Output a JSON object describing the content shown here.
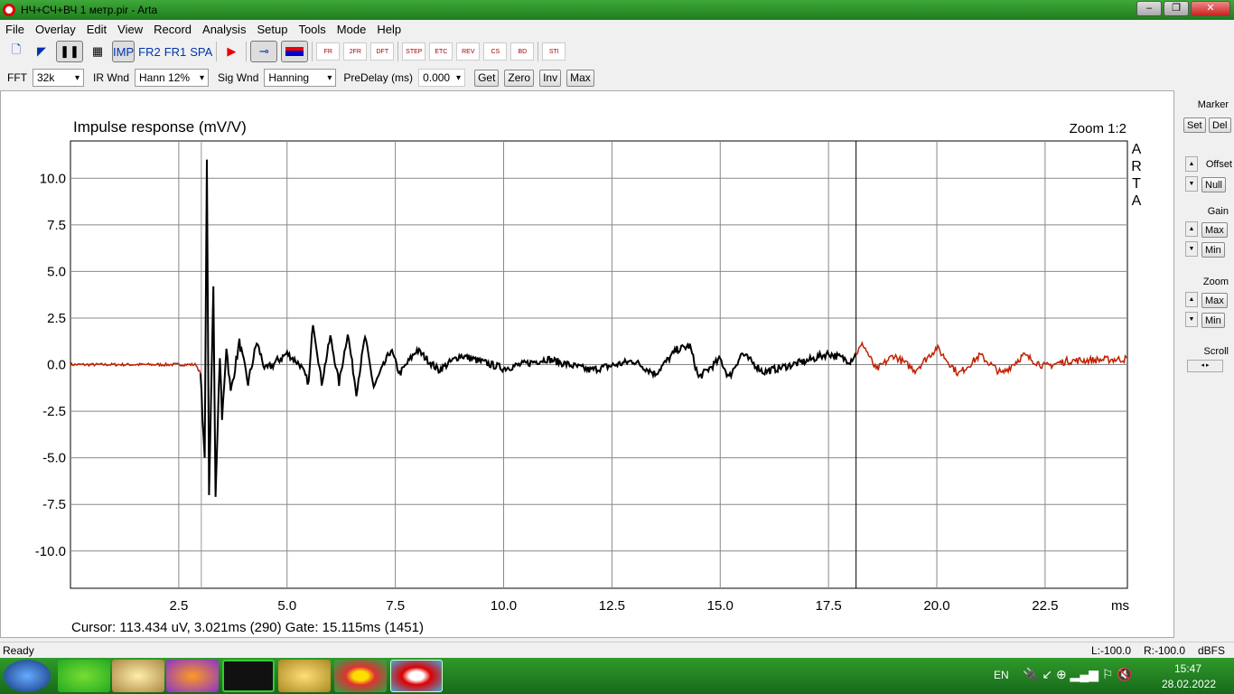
{
  "window": {
    "title": "НЧ+СЧ+ВЧ 1 метр.pir - Arta",
    "buttons": [
      "‒",
      "❐",
      "✕"
    ]
  },
  "menu": [
    "File",
    "Overlay",
    "Edit",
    "View",
    "Record",
    "Analysis",
    "Setup",
    "Tools",
    "Mode",
    "Help"
  ],
  "toolbar": {
    "imp": "IMP",
    "fr2": "FR2",
    "fr1": "FR1",
    "spa": "SPA",
    "graphs": [
      "FR",
      "2FR",
      "DFT",
      "STEP",
      "ETC",
      "REV",
      "CS",
      "BD",
      "STI"
    ]
  },
  "controls": {
    "fft_label": "FFT",
    "fft": "32k",
    "irwnd_label": "IR Wnd",
    "irwnd": "Hann 12%",
    "sigwnd_label": "Sig Wnd",
    "sigwnd": "Hanning",
    "predelay_label": "PreDelay (ms)",
    "predelay": "0.000",
    "get": "Get",
    "zero": "Zero",
    "inv": "Inv",
    "max": "Max"
  },
  "side": {
    "marker": "Marker",
    "set": "Set",
    "del": "Del",
    "offset": "Offset",
    "null": "Null",
    "gain": "Gain",
    "gain_max": "Max",
    "gain_min": "Min",
    "zoom": "Zoom",
    "zoom_max": "Max",
    "zoom_min": "Min",
    "scroll": "Scroll"
  },
  "chart_data": {
    "type": "line",
    "title": "Impulse response (mV/V)",
    "zoom_label": "Zoom 1:2",
    "watermark": "ARTA",
    "xlabel": "ms",
    "xlim": [
      0,
      24.4
    ],
    "ylim": [
      -12,
      12
    ],
    "xticks": [
      "2.5",
      "5.0",
      "7.5",
      "10.0",
      "12.5",
      "15.0",
      "17.5",
      "20.0",
      "22.5"
    ],
    "yticks": [
      "10.0",
      "7.5",
      "5.0",
      "2.5",
      "0.0",
      "-2.5",
      "-5.0",
      "-7.5",
      "-10.0"
    ],
    "grid": true,
    "gate_ms": [
      3.021,
      18.136
    ],
    "colors": {
      "in_gate": "#000000",
      "out_gate": "#c02000"
    },
    "points": [
      [
        0,
        0
      ],
      [
        2.9,
        0
      ],
      [
        3.0,
        -0.5
      ],
      [
        3.1,
        -5
      ],
      [
        3.15,
        11
      ],
      [
        3.2,
        -7
      ],
      [
        3.3,
        4.2
      ],
      [
        3.35,
        -7.1
      ],
      [
        3.45,
        0.5
      ],
      [
        3.5,
        -3
      ],
      [
        3.6,
        1
      ],
      [
        3.7,
        -1.5
      ],
      [
        3.9,
        1.2
      ],
      [
        4.1,
        -1
      ],
      [
        4.3,
        1.2
      ],
      [
        4.5,
        -0.3
      ],
      [
        5.0,
        0.6
      ],
      [
        5.3,
        0
      ],
      [
        5.5,
        -1
      ],
      [
        5.6,
        2.3
      ],
      [
        5.8,
        -1
      ],
      [
        6.0,
        1.5
      ],
      [
        6.2,
        -1
      ],
      [
        6.4,
        1.7
      ],
      [
        6.6,
        -1.5
      ],
      [
        6.8,
        1.5
      ],
      [
        7.0,
        -1.2
      ],
      [
        7.4,
        0.8
      ],
      [
        7.6,
        -0.5
      ],
      [
        8.0,
        0.8
      ],
      [
        8.5,
        -0.3
      ],
      [
        9.0,
        0.5
      ],
      [
        10,
        -0.2
      ],
      [
        11,
        0.3
      ],
      [
        12,
        -0.3
      ],
      [
        13,
        0.2
      ],
      [
        13.5,
        -0.5
      ],
      [
        14,
        0.8
      ],
      [
        14.3,
        1.0
      ],
      [
        14.5,
        -0.7
      ],
      [
        15,
        0.3
      ],
      [
        15.2,
        -0.7
      ],
      [
        15.5,
        0.6
      ],
      [
        16,
        -0.4
      ],
      [
        17,
        0.2
      ],
      [
        17.5,
        0.6
      ],
      [
        18,
        0.2
      ],
      [
        18.3,
        1.1
      ],
      [
        18.6,
        -0.3
      ],
      [
        19,
        0.5
      ],
      [
        19.5,
        -0.3
      ],
      [
        20,
        0.9
      ],
      [
        20.5,
        -0.5
      ],
      [
        21,
        0.5
      ],
      [
        21.5,
        -0.5
      ],
      [
        22,
        0.5
      ],
      [
        22.5,
        -0.1
      ],
      [
        23,
        0.2
      ],
      [
        24.4,
        0.3
      ]
    ]
  },
  "readout": "Cursor: 113.434 uV, 3.021ms (290)  Gate: 15.115ms (1451)",
  "status": {
    "text": "Ready",
    "l": "L:-100.0",
    "r": "R:-100.0",
    "unit": "dBFS"
  },
  "tray": {
    "lang": "EN",
    "time": "15:47",
    "date": "28.02.2022"
  }
}
